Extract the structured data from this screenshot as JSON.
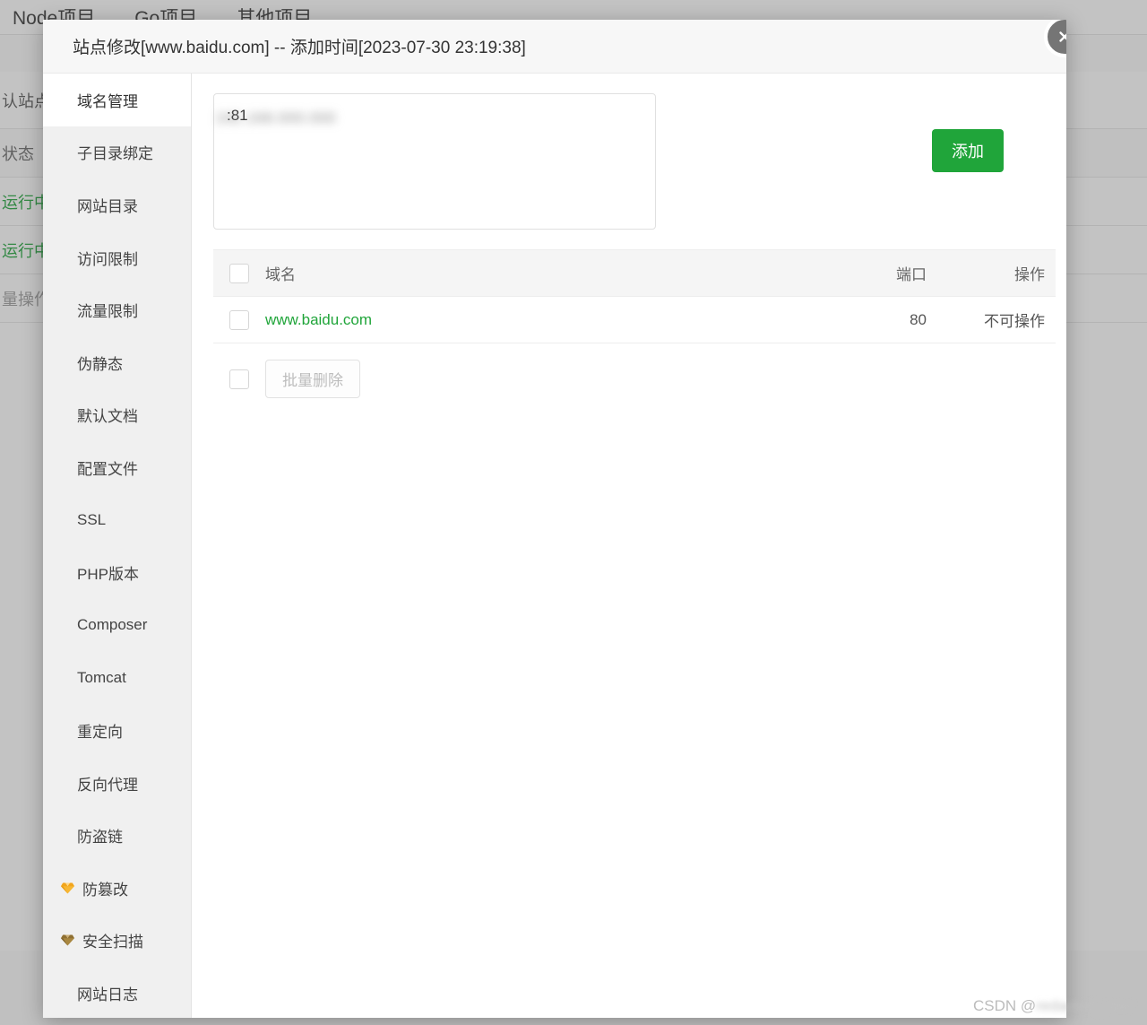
{
  "background": {
    "tabs": [
      {
        "label": "Node项目"
      },
      {
        "label": "Go项目"
      },
      {
        "label": "其他项目"
      }
    ],
    "rows": [
      {
        "cells": [
          "认站点"
        ]
      },
      {
        "cells": [
          "状态"
        ]
      },
      {
        "cells": [
          "运行中"
        ]
      },
      {
        "cells": [
          "运行中"
        ]
      },
      {
        "cells": [
          "量操作"
        ]
      }
    ],
    "partial_labels": {
      "default_site": "认站点",
      "status": "状态",
      "running_1": "运行中",
      "running_2": "运行中",
      "batch_ops": "量操作"
    }
  },
  "modal": {
    "title": "站点修改[www.baidu.com] -- 添加时间[2023-07-30 23:19:38]",
    "close_icon": "close-icon",
    "sidebar": {
      "items": [
        {
          "label": "域名管理",
          "active": true,
          "icon": null
        },
        {
          "label": "子目录绑定",
          "active": false,
          "icon": null
        },
        {
          "label": "网站目录",
          "active": false,
          "icon": null
        },
        {
          "label": "访问限制",
          "active": false,
          "icon": null
        },
        {
          "label": "流量限制",
          "active": false,
          "icon": null
        },
        {
          "label": "伪静态",
          "active": false,
          "icon": null
        },
        {
          "label": "默认文档",
          "active": false,
          "icon": null
        },
        {
          "label": "配置文件",
          "active": false,
          "icon": null
        },
        {
          "label": "SSL",
          "active": false,
          "icon": null
        },
        {
          "label": "PHP版本",
          "active": false,
          "icon": null
        },
        {
          "label": "Composer",
          "active": false,
          "icon": null
        },
        {
          "label": "Tomcat",
          "active": false,
          "icon": null
        },
        {
          "label": "重定向",
          "active": false,
          "icon": null
        },
        {
          "label": "反向代理",
          "active": false,
          "icon": null
        },
        {
          "label": "防盗链",
          "active": false,
          "icon": null
        },
        {
          "label": "防篡改",
          "active": false,
          "icon": "gem-icon-gold"
        },
        {
          "label": "安全扫描",
          "active": false,
          "icon": "gem-icon-bronze"
        },
        {
          "label": "网站日志",
          "active": false,
          "icon": null
        }
      ]
    },
    "main": {
      "domain_input": {
        "value": ":81",
        "redacted_prefix": "192.168.000.000",
        "placeholder": ""
      },
      "add_button": "添加",
      "table": {
        "headers": {
          "domain": "域名",
          "port": "端口",
          "action": "操作"
        },
        "rows": [
          {
            "domain": "www.baidu.com",
            "port": "80",
            "action": "不可操作"
          }
        ]
      },
      "bulk_delete_button": "批量删除"
    }
  },
  "watermark": {
    "prefix": "CSDN @",
    "redacted_name": "redacted_user"
  },
  "colors": {
    "accent_green": "#20a53a",
    "title_bar": "#f7f7f7",
    "sidebar": "#f0f0f0",
    "table_head": "#f5f5f5",
    "gem_gold": "#f5a623",
    "gem_bronze": "#9b7d3a",
    "close_circle": "#757575"
  }
}
